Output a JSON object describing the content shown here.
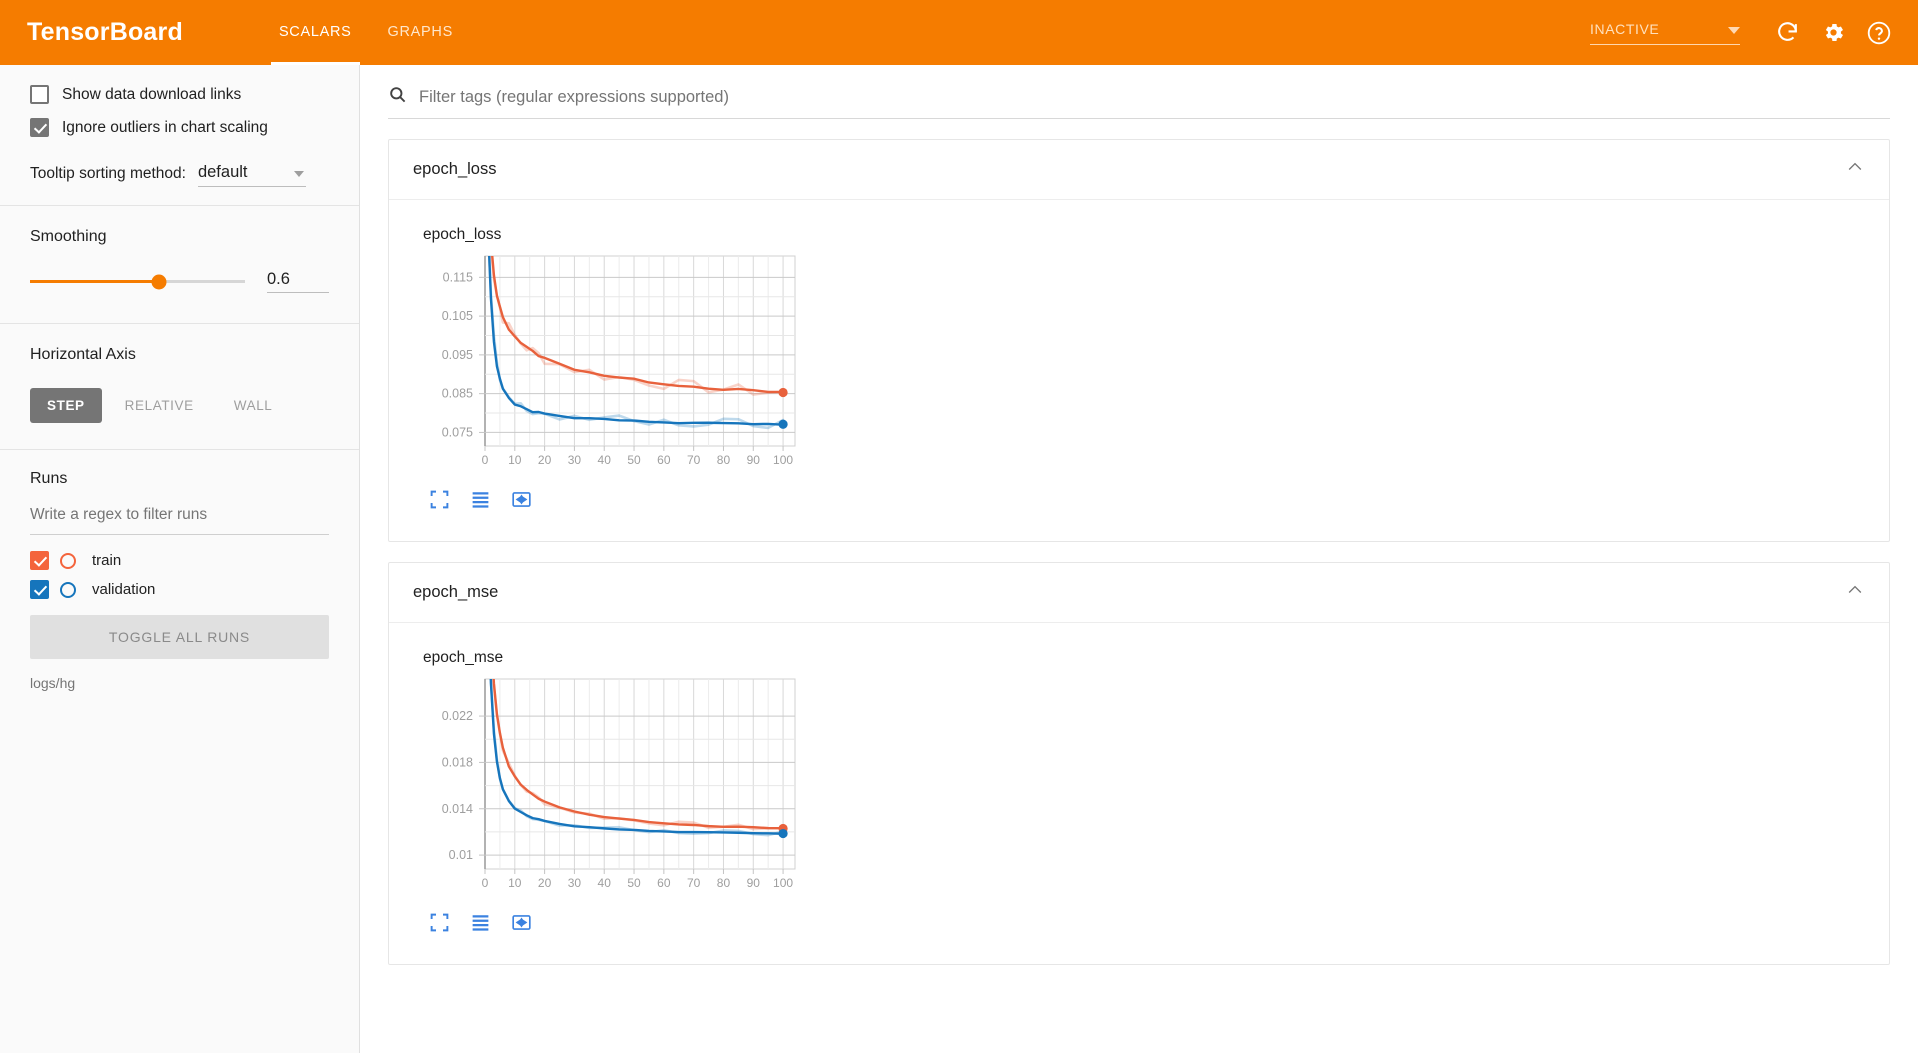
{
  "header": {
    "brand": "TensorBoard",
    "tabs": [
      {
        "label": "SCALARS",
        "active": true
      },
      {
        "label": "GRAPHS",
        "active": false
      }
    ],
    "status_select": "INACTIVE",
    "icons": [
      "refresh-icon",
      "gear-icon",
      "help-icon"
    ],
    "accent_color": "#f57c00"
  },
  "sidebar": {
    "show_download_links": {
      "label": "Show data download links",
      "checked": false
    },
    "ignore_outliers": {
      "label": "Ignore outliers in chart scaling",
      "checked": true
    },
    "tooltip_sorting": {
      "label": "Tooltip sorting method:",
      "value": "default"
    },
    "smoothing": {
      "title": "Smoothing",
      "value": "0.6",
      "fraction": 0.6
    },
    "horizontal_axis": {
      "title": "Horizontal Axis",
      "options": [
        "STEP",
        "RELATIVE",
        "WALL"
      ],
      "selected": "STEP"
    },
    "runs": {
      "title": "Runs",
      "filter_placeholder": "Write a regex to filter runs",
      "items": [
        {
          "label": "train",
          "checked": true,
          "color": "#f4643c"
        },
        {
          "label": "validation",
          "checked": true,
          "color": "#1675bc"
        }
      ],
      "toggle_all_label": "TOGGLE ALL RUNS",
      "log_path": "logs/hg"
    }
  },
  "main": {
    "filter_placeholder": "Filter tags (regular expressions supported)",
    "cards": [
      {
        "title": "epoch_loss",
        "chart_index": 0
      },
      {
        "title": "epoch_mse",
        "chart_index": 1
      }
    ],
    "chart_tool_names": [
      "expand-icon",
      "data-table-icon",
      "fit-domain-icon"
    ]
  },
  "chart_data": [
    {
      "type": "line",
      "title": "epoch_loss",
      "xlabel": "",
      "ylabel": "",
      "xlim": [
        0,
        104
      ],
      "ylim": [
        0.0715,
        0.1205
      ],
      "xticks": [
        0,
        10,
        20,
        30,
        40,
        50,
        60,
        70,
        80,
        90,
        100
      ],
      "yticks": [
        0.075,
        0.085,
        0.095,
        0.105,
        0.115
      ],
      "grid": true,
      "legend": "none",
      "series": [
        {
          "name": "train",
          "color": "#e8613c",
          "x": [
            0,
            1,
            2,
            3,
            4,
            5,
            6,
            8,
            10,
            12,
            14,
            16,
            18,
            20,
            25,
            30,
            35,
            40,
            45,
            50,
            55,
            60,
            65,
            70,
            75,
            80,
            85,
            90,
            95,
            100
          ],
          "values": [
            0.163,
            0.139,
            0.124,
            0.1155,
            0.1105,
            0.1072,
            0.1049,
            0.1018,
            0.0998,
            0.0982,
            0.0969,
            0.0958,
            0.0949,
            0.0941,
            0.0926,
            0.0914,
            0.0906,
            0.0897,
            0.0891,
            0.0886,
            0.0881,
            0.0876,
            0.0872,
            0.0868,
            0.0865,
            0.0862,
            0.086,
            0.0857,
            0.0855,
            0.0853
          ]
        },
        {
          "name": "validation",
          "color": "#1675bc",
          "x": [
            0,
            1,
            2,
            3,
            4,
            5,
            6,
            8,
            10,
            12,
            14,
            16,
            18,
            20,
            25,
            30,
            35,
            40,
            45,
            50,
            55,
            60,
            65,
            70,
            75,
            80,
            85,
            90,
            95,
            100
          ],
          "values": [
            0.155,
            0.128,
            0.1095,
            0.0985,
            0.0922,
            0.0886,
            0.0864,
            0.0838,
            0.0824,
            0.0815,
            0.0809,
            0.0804,
            0.0801,
            0.0798,
            0.0792,
            0.0788,
            0.0785,
            0.0783,
            0.0781,
            0.0779,
            0.0778,
            0.0777,
            0.0776,
            0.0775,
            0.0774,
            0.0773,
            0.0773,
            0.0772,
            0.0772,
            0.0771
          ]
        }
      ],
      "endpoints": [
        {
          "name": "train",
          "x": 100,
          "y": 0.0853,
          "color": "#e8613c"
        },
        {
          "name": "validation",
          "x": 100,
          "y": 0.0771,
          "color": "#1675bc"
        }
      ]
    },
    {
      "type": "line",
      "title": "epoch_mse",
      "xlabel": "",
      "ylabel": "",
      "xlim": [
        0,
        104
      ],
      "ylim": [
        0.0088,
        0.0252
      ],
      "xticks": [
        0,
        10,
        20,
        30,
        40,
        50,
        60,
        70,
        80,
        90,
        100
      ],
      "yticks": [
        0.01,
        0.014,
        0.018,
        0.022
      ],
      "grid": true,
      "legend": "none",
      "series": [
        {
          "name": "train",
          "color": "#e8613c",
          "x": [
            0,
            1,
            2,
            3,
            4,
            5,
            6,
            8,
            10,
            12,
            14,
            16,
            18,
            20,
            25,
            30,
            35,
            40,
            45,
            50,
            55,
            60,
            65,
            70,
            75,
            80,
            85,
            90,
            95,
            100
          ],
          "values": [
            0.0455,
            0.0352,
            0.0288,
            0.0248,
            0.0222,
            0.0205,
            0.0193,
            0.0177,
            0.0168,
            0.0161,
            0.0156,
            0.0152,
            0.0149,
            0.0146,
            0.0141,
            0.0138,
            0.0135,
            0.0133,
            0.01315,
            0.013,
            0.01288,
            0.01277,
            0.01268,
            0.0126,
            0.01253,
            0.01247,
            0.01242,
            0.01238,
            0.01234,
            0.0123
          ]
        },
        {
          "name": "validation",
          "color": "#1675bc",
          "x": [
            0,
            1,
            2,
            3,
            4,
            5,
            6,
            8,
            10,
            12,
            14,
            16,
            18,
            20,
            25,
            30,
            35,
            40,
            45,
            50,
            55,
            60,
            65,
            70,
            75,
            80,
            85,
            90,
            95,
            100
          ],
          "values": [
            0.0432,
            0.0318,
            0.0248,
            0.0205,
            0.0181,
            0.0166,
            0.0157,
            0.01465,
            0.01405,
            0.01368,
            0.01342,
            0.01322,
            0.01307,
            0.01294,
            0.01268,
            0.0125,
            0.01238,
            0.01228,
            0.01221,
            0.01215,
            0.0121,
            0.01206,
            0.01202,
            0.01199,
            0.01196,
            0.01194,
            0.01192,
            0.0119,
            0.01188,
            0.01186
          ]
        }
      ],
      "endpoints": [
        {
          "name": "train",
          "x": 100,
          "y": 0.0123,
          "color": "#e8613c"
        },
        {
          "name": "validation",
          "x": 100,
          "y": 0.01186,
          "color": "#1675bc"
        }
      ]
    }
  ]
}
